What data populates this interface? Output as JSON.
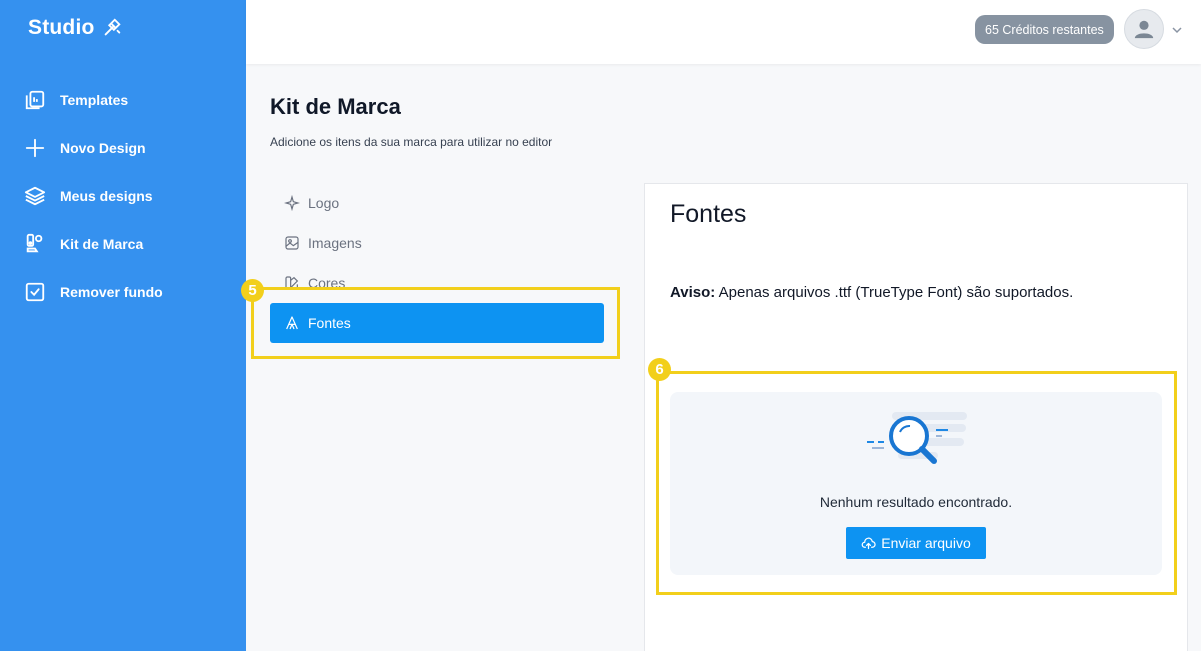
{
  "brand": {
    "name": "Studio"
  },
  "nav": [
    {
      "label": "Templates",
      "icon": "templates-icon"
    },
    {
      "label": "Novo Design",
      "icon": "plus-icon"
    },
    {
      "label": "Meus designs",
      "icon": "layers-icon"
    },
    {
      "label": "Kit de Marca",
      "icon": "brand-kit-icon"
    },
    {
      "label": "Remover fundo",
      "icon": "checkbox-icon"
    }
  ],
  "topbar": {
    "credits": "65 Créditos restantes"
  },
  "page": {
    "title": "Kit de Marca",
    "subtitle": "Adicione os itens da sua marca para utilizar no editor"
  },
  "tabs": [
    {
      "label": "Logo",
      "icon": "sparkle-icon"
    },
    {
      "label": "Imagens",
      "icon": "image-icon"
    },
    {
      "label": "Cores",
      "icon": "palette-icon"
    },
    {
      "label": "Fontes",
      "icon": "font-icon",
      "active": true
    }
  ],
  "panel": {
    "title": "Fontes",
    "notice_label": "Aviso:",
    "notice_text": "Apenas arquivos .ttf (TrueType Font) são suportados.",
    "empty_text": "Nenhum resultado encontrado.",
    "upload_label": "Enviar arquivo"
  },
  "annotations": {
    "badge_5": "5",
    "badge_6": "6"
  },
  "colors": {
    "sidebar": "#3591ef",
    "accent": "#0d93f2",
    "highlight": "#f2cf1b",
    "credits_bg": "#8793a1"
  }
}
